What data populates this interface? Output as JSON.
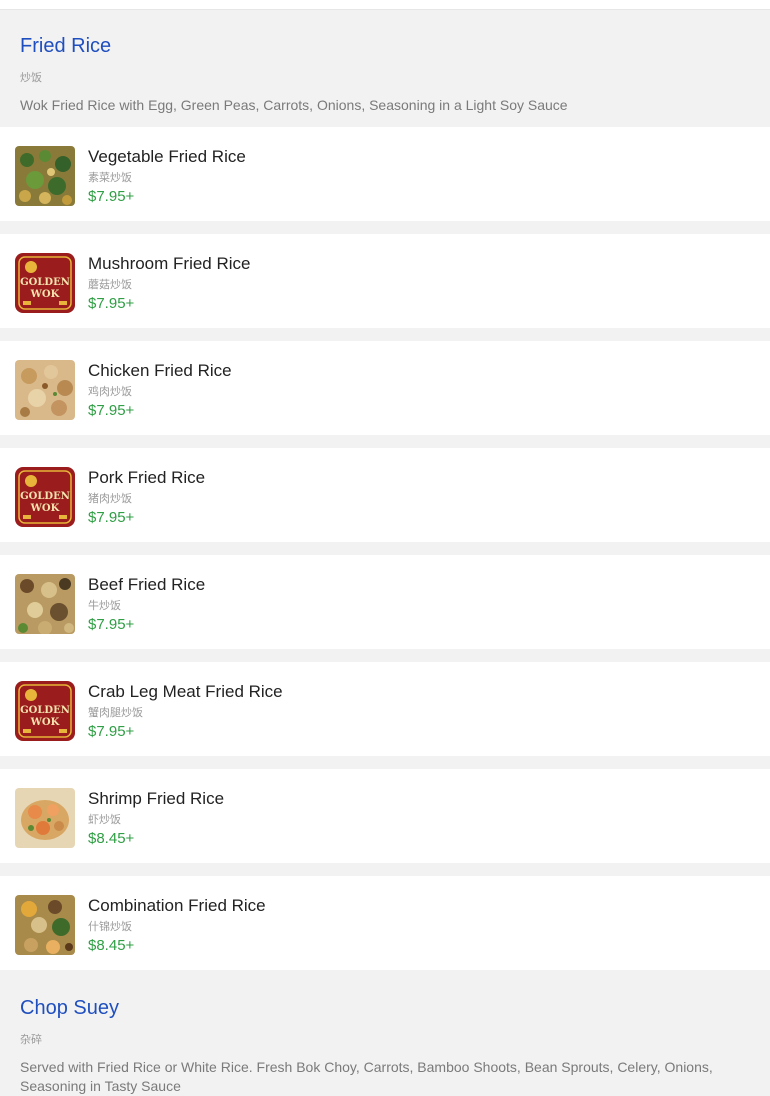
{
  "colors": {
    "section_title": "#1f4fbf",
    "price": "#2f9e44",
    "item_name": "#222222",
    "muted": "#9a9a9a",
    "logo_red": "#9b1c1c",
    "logo_gold": "#e8b43a"
  },
  "sections": [
    {
      "title": "Fried Rice",
      "cn": "炒饭",
      "description": "Wok Fried Rice with Egg, Green Peas, Carrots, Onions, Seasoning in a Light Soy Sauce"
    },
    {
      "title": "Chop Suey",
      "cn": "杂碎",
      "description": "Served with Fried Rice or White Rice. Fresh Bok Choy, Carrots, Bamboo Shoots, Bean Sprouts, Celery, Onions, Seasoning in Tasty Sauce"
    }
  ],
  "items": [
    {
      "name": "Vegetable Fried Rice",
      "cn": "素菜炒饭",
      "price": "$7.95+",
      "image": "fried-rice-photo-green"
    },
    {
      "name": "Mushroom Fried Rice",
      "cn": "蘑菇炒饭",
      "price": "$7.95+",
      "image": "golden-wok-logo"
    },
    {
      "name": "Chicken Fried Rice",
      "cn": "鸡肉炒饭",
      "price": "$7.95+",
      "image": "fried-rice-photo-chicken"
    },
    {
      "name": "Pork Fried Rice",
      "cn": "猪肉炒饭",
      "price": "$7.95+",
      "image": "golden-wok-logo"
    },
    {
      "name": "Beef Fried Rice",
      "cn": "牛炒饭",
      "price": "$7.95+",
      "image": "fried-rice-photo-beef"
    },
    {
      "name": "Crab Leg Meat Fried Rice",
      "cn": "蟹肉腿炒饭",
      "price": "$7.95+",
      "image": "golden-wok-logo"
    },
    {
      "name": "Shrimp Fried Rice",
      "cn": "虾炒饭",
      "price": "$8.45+",
      "image": "fried-rice-photo-shrimp"
    },
    {
      "name": "Combination Fried Rice",
      "cn": "什锦炒饭",
      "price": "$8.45+",
      "image": "fried-rice-photo-combo"
    }
  ],
  "logo": {
    "line1": "GOLDEN",
    "line2": "WOK"
  }
}
